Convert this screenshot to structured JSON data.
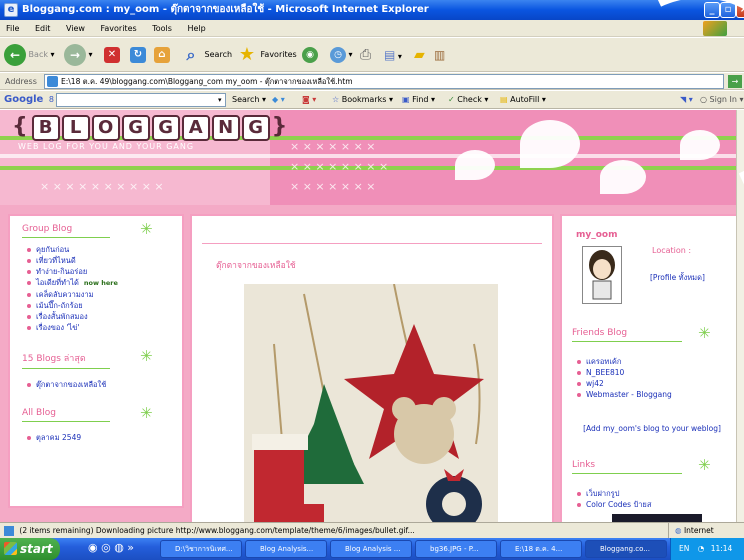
{
  "window": {
    "title": "Bloggang.com : my_oom - ตุ๊กตาจากของเหลือใช้ - Microsoft Internet Explorer"
  },
  "menu": [
    "File",
    "Edit",
    "View",
    "Favorites",
    "Tools",
    "Help"
  ],
  "toolbar": {
    "back": "Back",
    "search": "Search",
    "favorites": "Favorites"
  },
  "address": {
    "label": "Address",
    "url": "E:\\18 ต.ค. 49\\bloggang.com\\Bloggang_com  my_oom - ตุ๊กตาจากของเหลือใช้.htm",
    "go": "Go"
  },
  "googlebar": {
    "brand": "Google",
    "search": "Search",
    "bookmarks": "Bookmarks",
    "find": "Find",
    "check": "Check",
    "autofill": "AutoFill",
    "signin": "Sign In"
  },
  "banner": {
    "logo_letters": [
      "B",
      "L",
      "O",
      "G",
      "G",
      "A",
      "N",
      "G"
    ],
    "tagline": "WEB LOG FOR YOU AND YOUR GANG"
  },
  "left": {
    "group_title": "Group Blog",
    "group_items": [
      "คุยกันก่อน",
      "เที่ยวที่ไหนดี",
      "ทำง่าย-กินอร่อย",
      "ไอเดียที่ทำได้",
      "เคล็ดลับความงาม",
      "เม้นปึ๊ก-ถักร้อย",
      "เรื่องสั้นพักสมอง",
      "เรื่องของ 'ไข่'"
    ],
    "now_here": "now here",
    "recent_title": "15 Blogs ล่าสุด",
    "recent_items": [
      "ตุ๊กตาจากของเหลือใช้"
    ],
    "all_title": "All Blog",
    "all_items": [
      "ตุลาคม 2549"
    ]
  },
  "main": {
    "post_title": "ตุ๊กตาจากของเหลือใช้"
  },
  "right": {
    "username": "my_oom",
    "location": "Location :",
    "profile_link": "[Profile ทั้งหมด]",
    "friends_title": "Friends Blog",
    "friends": [
      "แครอทเค้ก",
      "N_BEE810",
      "wj42",
      "Webmaster - Bloggang"
    ],
    "add_link": "[Add my_oom's blog to your weblog]",
    "links_title": "Links",
    "links": [
      "เว็บฝากรูป",
      "Color Codes ป้ายส"
    ]
  },
  "status": {
    "text": "(2 items remaining) Downloading picture http://www.bloggang.com/template/theme/6/images/bullet.gif...",
    "zone": "Internet"
  },
  "taskbar": {
    "start": "start",
    "tasks": [
      "D:\\วิชาการนิเทศ...",
      "Blog Analysis...",
      "Blog Analysis ...",
      "bg36.JPG - P...",
      "E:\\18 ต.ค. 4...",
      "Bloggang.co..."
    ],
    "lang": "EN",
    "clock": "11:14"
  },
  "colors": {
    "pink": "#f08fb8",
    "green": "#7fcf4e",
    "link": "#1a2fb8"
  }
}
